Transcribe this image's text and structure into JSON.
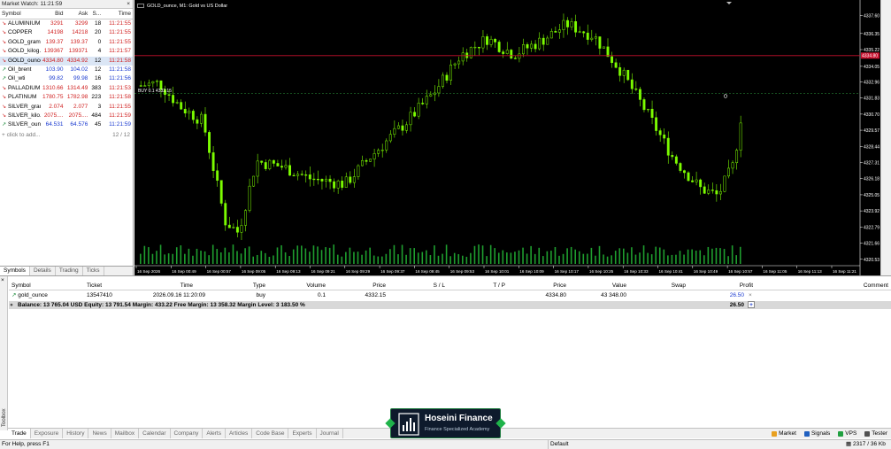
{
  "market_watch": {
    "title": "Market Watch: 11:21:59",
    "close_glyph": "×",
    "headers": {
      "symbol": "Symbol",
      "bid": "Bid",
      "ask": "Ask",
      "spread": "S...",
      "time": "Time"
    },
    "rows": [
      {
        "symbol": "ALUMINIUM",
        "bid": "3291",
        "ask": "3299",
        "spread": "18",
        "time": "11:21:55",
        "dir": "down"
      },
      {
        "symbol": "COPPER",
        "bid": "14198",
        "ask": "14218",
        "spread": "20",
        "time": "11:21:55",
        "dir": "down"
      },
      {
        "symbol": "GOLD_gram",
        "bid": "139.37",
        "ask": "139.37",
        "spread": "0",
        "time": "11:21:55",
        "dir": "down"
      },
      {
        "symbol": "GOLD_kilog...",
        "bid": "139367",
        "ask": "139371",
        "spread": "4",
        "time": "11:21:57",
        "dir": "down"
      },
      {
        "symbol": "GOLD_ounce",
        "bid": "4334.80",
        "ask": "4334.92",
        "spread": "12",
        "time": "11:21:58",
        "dir": "down"
      },
      {
        "symbol": "Oil_brent",
        "bid": "103.90",
        "ask": "104.02",
        "spread": "12",
        "time": "11:21:58",
        "dir": "up"
      },
      {
        "symbol": "Oil_wti",
        "bid": "99.82",
        "ask": "99.98",
        "spread": "16",
        "time": "11:21:56",
        "dir": "up"
      },
      {
        "symbol": "PALLADIUM",
        "bid": "1310.66",
        "ask": "1314.49",
        "spread": "383",
        "time": "11:21:53",
        "dir": "down"
      },
      {
        "symbol": "PLATINUM",
        "bid": "1780.75",
        "ask": "1782.98",
        "spread": "223",
        "time": "11:21:58",
        "dir": "down"
      },
      {
        "symbol": "SILVER_gram",
        "bid": "2.074",
        "ask": "2.077",
        "spread": "3",
        "time": "11:21:55",
        "dir": "down"
      },
      {
        "symbol": "SILVER_kilo...",
        "bid": "2075....",
        "ask": "2075....",
        "spread": "484",
        "time": "11:21:59",
        "dir": "down"
      },
      {
        "symbol": "SILVER_oun...",
        "bid": "64.531",
        "ask": "64.576",
        "spread": "45",
        "time": "11:21:59",
        "dir": "up"
      }
    ],
    "add_label": "click to add...",
    "count": "12 / 12",
    "tabs": [
      "Symbols",
      "Details",
      "Trading",
      "Ticks"
    ]
  },
  "chart": {
    "title": "GOLD_ounce, M1:  Gold vs US Dollar",
    "buy_label": "BUY 0.1 4332.15",
    "bid_label": "4334.80",
    "price_labels": [
      "4337.60",
      "4336.35",
      "4335.22",
      "4334.05",
      "4332.96",
      "4331.83",
      "4330.70",
      "4329.57",
      "4328.44",
      "4327.31",
      "4326.18",
      "4325.05",
      "4323.92",
      "4322.79",
      "4321.66",
      "4320.53"
    ],
    "time_labels": [
      "16 Sep 2026",
      "16 Sep 00:49",
      "16 Sep 00:57",
      "16 Sep 09:05",
      "16 Sep 09:13",
      "16 Sep 09:21",
      "16 Sep 09:29",
      "16 Sep 09:37",
      "16 Sep 09:45",
      "16 Sep 09:53",
      "16 Sep 10:01",
      "16 Sep 10:09",
      "16 Sep 10:17",
      "16 Sep 10:25",
      "16 Sep 10:33",
      "16 Sep 10:41",
      "16 Sep 10:49",
      "16 Sep 10:57",
      "16 Sep 11:05",
      "16 Sep 11:13",
      "16 Sep 11:21"
    ],
    "colors": {
      "bg": "#000000",
      "candle": "#7CFC00",
      "bid_line": "#c8102e",
      "grid": "#404040",
      "axis_text": "#ffffff"
    }
  },
  "terminal": {
    "toolbox_label": "Toolbox",
    "close_glyph": "×",
    "headers": {
      "symbol": "Symbol",
      "ticket": "Ticket",
      "time": "Time",
      "type": "Type",
      "volume": "Volume",
      "price": "Price",
      "sl": "S / L",
      "tp": "T / P",
      "cur_price": "Price",
      "value": "Value",
      "swap": "Swap",
      "profit": "Profit",
      "comment": "Comment"
    },
    "position": {
      "symbol": "gold_ounce",
      "ticket": "13547410",
      "time": "2026.09.16 11:20:09",
      "type": "buy",
      "volume": "0.1",
      "price": "4332.15",
      "cur_price": "4334.80",
      "value": "43 348.00",
      "profit": "26.50"
    },
    "balance_line": "Balance: 13 765.04 USD  Equity: 13 791.54  Margin: 433.22  Free Margin: 13 358.32  Margin Level: 3 183.50 %",
    "total_profit": "26.50",
    "tabs": [
      "Trade",
      "Exposure",
      "History",
      "News",
      "Mailbox",
      "Calendar",
      "Company",
      "Alerts",
      "Articles",
      "Code Base",
      "Experts",
      "Journal"
    ],
    "tools": [
      "Market",
      "Signals",
      "VPS",
      "Tester"
    ]
  },
  "status": {
    "help": "For Help, press F1",
    "profile": "Default",
    "traffic": "2317 / 36 Kb"
  },
  "watermark": {
    "name": "Hoseini Finance",
    "subtitle": "Finance Specialized Academy"
  }
}
